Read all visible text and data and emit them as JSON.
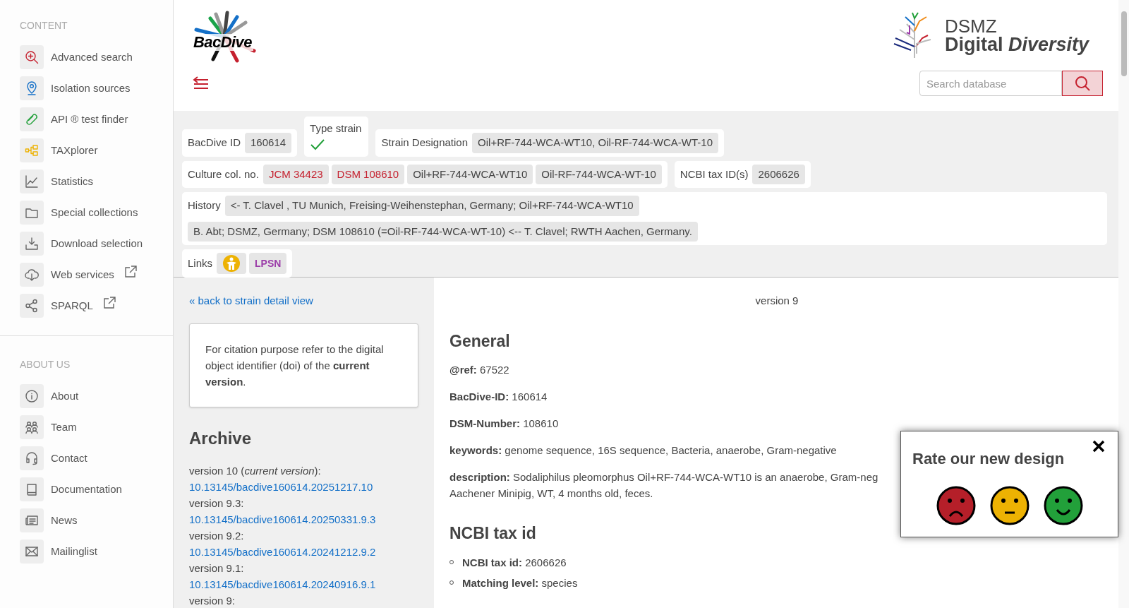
{
  "sidebar": {
    "sections": [
      {
        "heading": "CONTENT",
        "items": [
          {
            "label": "Advanced search",
            "external": false
          },
          {
            "label": "Isolation sources",
            "external": false
          },
          {
            "label": "API ® test finder",
            "external": false
          },
          {
            "label": "TAXplorer",
            "external": false
          },
          {
            "label": "Statistics",
            "external": false
          },
          {
            "label": "Special collections",
            "external": false
          },
          {
            "label": "Download selection",
            "external": false
          },
          {
            "label": "Web services",
            "external": true
          },
          {
            "label": "SPARQL",
            "external": true
          }
        ]
      },
      {
        "heading": "ABOUT US",
        "items": [
          {
            "label": "About",
            "external": false
          },
          {
            "label": "Team",
            "external": false
          },
          {
            "label": "Contact",
            "external": false
          },
          {
            "label": "Documentation",
            "external": false
          },
          {
            "label": "News",
            "external": false
          },
          {
            "label": "Mailinglist",
            "external": false
          }
        ]
      }
    ]
  },
  "header": {
    "logo_text": "BacDive",
    "partner_logo": {
      "line1": "DSMZ",
      "line2a": "Digital",
      "line2b": "Diversity"
    },
    "search": {
      "placeholder": "Search database"
    }
  },
  "strain": {
    "bacdive_id": {
      "label": "BacDive ID",
      "value": "160614"
    },
    "type_strain": {
      "label": "Type strain",
      "checked": true
    },
    "designation": {
      "label": "Strain Designation",
      "value": "Oil+RF-744-WCA-WT10, Oil-RF-744-WCA-WT-10"
    },
    "culture_collection": {
      "label": "Culture col. no.",
      "items": [
        {
          "text": "JCM 34423",
          "linked": true
        },
        {
          "text": "DSM 108610",
          "linked": true
        },
        {
          "text": "Oil+RF-744-WCA-WT10",
          "linked": false
        },
        {
          "text": "Oil-RF-744-WCA-WT-10",
          "linked": false
        }
      ]
    },
    "ncbi": {
      "label": "NCBI tax ID(s)",
      "value": "2606626"
    },
    "history": {
      "label": "History",
      "entries": [
        "<- T. Clavel , TU Munich, Freising-Weihenstephan, Germany; Oil+RF-744-WCA-WT10",
        "B. Abt; DSMZ, Germany; DSM 108610 (=Oil-RF-744-WCA-WT-10) <-- T. Clavel; RWTH Aachen, Germany."
      ]
    },
    "links": {
      "label": "Links",
      "items": [
        {
          "kind": "info"
        },
        {
          "kind": "lpsn",
          "text": "LPSN"
        }
      ]
    }
  },
  "archive_panel": {
    "back_link": "« back to strain detail view",
    "citation_note": "For citation purpose refer to the digital object identifier (doi) of the **current version**.",
    "heading": "Archive",
    "versions": [
      {
        "label": "version 10 (*current version*):",
        "doi": "10.13145/bacdive160614.20251217.10"
      },
      {
        "label": "version 9.3:",
        "doi": "10.13145/bacdive160614.20250331.9.3"
      },
      {
        "label": "version 9.2:",
        "doi": "10.13145/bacdive160614.20241212.9.2"
      },
      {
        "label": "version 9.1:",
        "doi": "10.13145/bacdive160614.20240916.9.1"
      },
      {
        "label": "version 9:"
      }
    ]
  },
  "detail": {
    "version_label": "version 9",
    "sections": [
      {
        "heading": "General",
        "kind": "fields",
        "fields": [
          {
            "lines": [
              "**@ref:** 67522"
            ]
          },
          {
            "lines": [
              "**BacDive-ID:** 160614"
            ]
          },
          {
            "lines": [
              "**DSM-Number:** 108610"
            ]
          },
          {
            "lines": [
              "**keywords:** genome sequence, 16S sequence, Bacteria, anaerobe, Gram-negative"
            ]
          },
          {
            "lines": [
              "**description:** Sodaliphilus pleomorphus Oil+RF-744-WCA-WT10 is an anaerobe, Gram-neg",
              "Aachener Minipig, WT, 4 months old, feces."
            ]
          }
        ]
      },
      {
        "heading": "NCBI tax id",
        "kind": "bullets",
        "fields": [
          {
            "lines": [
              "**NCBI tax id:** 2606626"
            ]
          },
          {
            "lines": [
              "**Matching level:** species"
            ]
          }
        ]
      }
    ]
  },
  "rating_popup": {
    "title": "Rate our new design",
    "faces": [
      {
        "kind": "sad",
        "color": "#b51f29"
      },
      {
        "kind": "neutral",
        "color": "#edb203"
      },
      {
        "kind": "happy",
        "color": "#22a03a"
      }
    ]
  }
}
